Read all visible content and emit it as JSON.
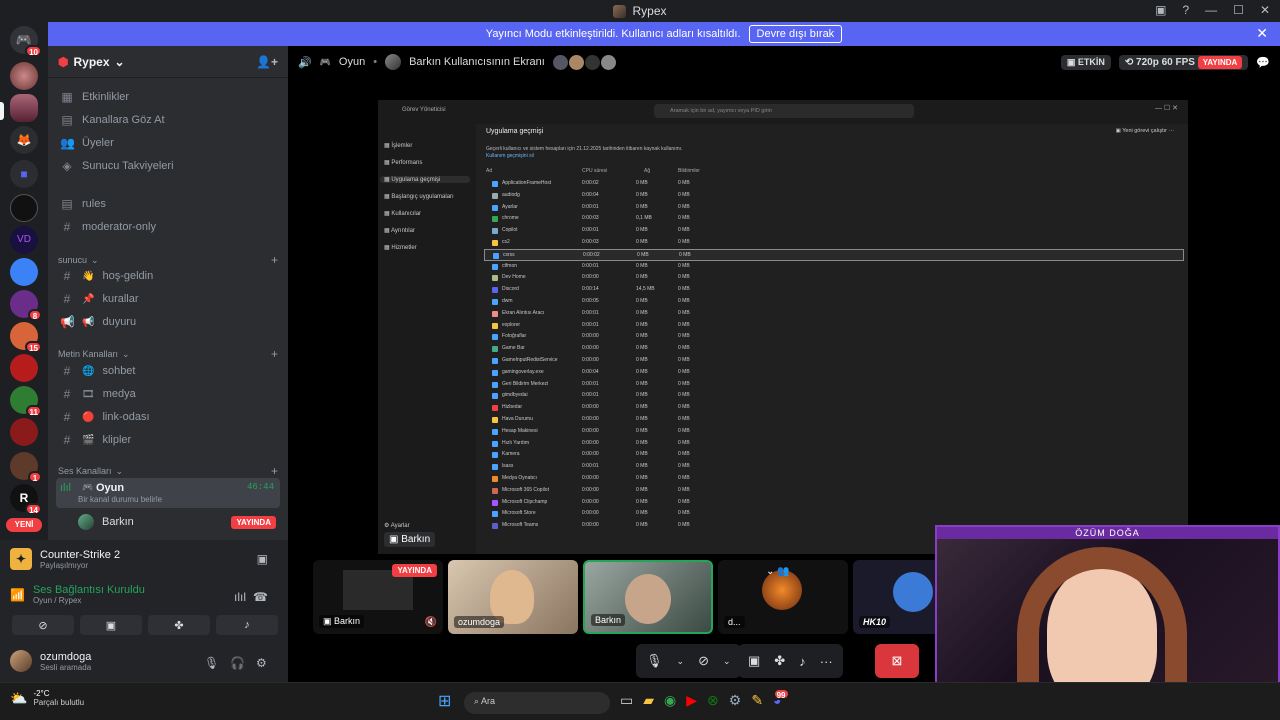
{
  "window": {
    "title": "Rypex"
  },
  "banner": {
    "message": "Yayıncı Modu etkinleştirildi. Kullanıcı adları kısaltıldı.",
    "button": "Devre dışı bırak"
  },
  "rail": {
    "badges": [
      "10",
      "8",
      "15",
      "11",
      "1",
      "14"
    ],
    "new_label": "YENİ"
  },
  "guild": {
    "name": "Rypex",
    "top_items": [
      "Etkinlikler",
      "Kanallara Göz At",
      "Üyeler",
      "Sunucu Takviyeleri"
    ],
    "text_channels_a": [
      "rules",
      "moderator-only"
    ],
    "cat_sunucu": "sunucu",
    "sunucu_channels": [
      "hoş-geldin",
      "kurallar",
      "duyuru"
    ],
    "cat_metin": "Metin Kanalları",
    "metin_channels": [
      "sohbet",
      "medya",
      "link-odası",
      "klipler"
    ],
    "cat_ses": "Ses Kanalları",
    "voice_channel": {
      "name": "Oyun",
      "timer": "46:44",
      "status_hint": "Bir kanal durumu belirle",
      "member": "Barkın",
      "member_badge": "YAYINDA"
    }
  },
  "user_panel": {
    "game": "Counter-Strike 2",
    "game_status": "Paylaşılmıyor",
    "voice_status": "Ses Bağlantısı Kuruldu",
    "voice_location": "Oyun / Rypex",
    "username": "ozumdoga",
    "user_status": "Sesli aramada"
  },
  "stream_header": {
    "channel": "Oyun",
    "screen_title": "Barkın Kullanıcısının Ekranı",
    "active_badge": "ETKİN",
    "quality": "720p 60 FPS",
    "live": "YAYINDA"
  },
  "task_manager": {
    "app_title": "Görev Yöneticisi",
    "search_placeholder": "Aramak için bir ad, yayımcı veya PID girin",
    "sidebar": [
      "İşlemler",
      "Performans",
      "Uygulama geçmişi",
      "Başlangıç uygulamaları",
      "Kullanıcılar",
      "Ayrıntılar",
      "Hizmetler",
      "Ayarlar"
    ],
    "heading": "Uygulama geçmişi",
    "action": "Yeni görevi çalıştır",
    "desc": "Geçerli kullanıcı ve sistem hesapları için 21.12.2025 tarihinden itibaren kaynak kullanımı.",
    "delete_link": "Kullanım geçmişini sil",
    "columns": [
      "Ad",
      "CPU süresi",
      "Ağ",
      "Bildirimler"
    ],
    "rows": [
      [
        "ApplicationFrameHost",
        "0:00:02",
        "0 MB",
        "0 MB"
      ],
      [
        "audiodg",
        "0:00:04",
        "0 MB",
        "0 MB"
      ],
      [
        "Ayarlar",
        "0:00:01",
        "0 MB",
        "0 MB"
      ],
      [
        "chrome",
        "0:00:03",
        "0,1 MB",
        "0 MB"
      ],
      [
        "Copilot",
        "0:00:01",
        "0 MB",
        "0 MB"
      ],
      [
        "cs2",
        "0:00:03",
        "0 MB",
        "0 MB"
      ],
      [
        "csrss",
        "0:00:02",
        "0 MB",
        "0 MB"
      ],
      [
        "ctfmon",
        "0:00:01",
        "0 MB",
        "0 MB"
      ],
      [
        "Dev Home",
        "0:00:00",
        "0 MB",
        "0 MB"
      ],
      [
        "Discord",
        "0:00:14",
        "14,5 MB",
        "0 MB"
      ],
      [
        "dwm",
        "0:00:05",
        "0 MB",
        "0 MB"
      ],
      [
        "Ekran Alıntısı Aracı",
        "0:00:01",
        "0 MB",
        "0 MB"
      ],
      [
        "explorer",
        "0:00:01",
        "0 MB",
        "0 MB"
      ],
      [
        "Fotoğraflar",
        "0:00:00",
        "0 MB",
        "0 MB"
      ],
      [
        "Game Bar",
        "0:00:00",
        "0 MB",
        "0 MB"
      ],
      [
        "GameInputRedistService",
        "0:00:00",
        "0 MB",
        "0 MB"
      ],
      [
        "gamingoverlay.exe",
        "0:00:04",
        "0 MB",
        "0 MB"
      ],
      [
        "Geri Bildirim Merkezi",
        "0:00:01",
        "0 MB",
        "0 MB"
      ],
      [
        "gimdbyedai",
        "0:00:01",
        "0 MB",
        "0 MB"
      ],
      [
        "Hizbedar",
        "0:00:00",
        "0 MB",
        "0 MB"
      ],
      [
        "Hava Durumu",
        "0:00:00",
        "0 MB",
        "0 MB"
      ],
      [
        "Hesap Makinesi",
        "0:00:00",
        "0 MB",
        "0 MB"
      ],
      [
        "Hızlı Yardım",
        "0:00:00",
        "0 MB",
        "0 MB"
      ],
      [
        "Kamera",
        "0:00:00",
        "0 MB",
        "0 MB"
      ],
      [
        "lsass",
        "0:00:01",
        "0 MB",
        "0 MB"
      ],
      [
        "Medya Oynatıcı",
        "0:00:00",
        "0 MB",
        "0 MB"
      ],
      [
        "Microsoft 365 Copilot",
        "0:00:00",
        "0 MB",
        "0 MB"
      ],
      [
        "Microsoft Clipchamp",
        "0:00:00",
        "0 MB",
        "0 MB"
      ],
      [
        "Microsoft Store",
        "0:00:00",
        "0 MB",
        "0 MB"
      ],
      [
        "Microsoft Teams",
        "0:00:00",
        "0 MB",
        "0 MB"
      ]
    ],
    "stream_label": "Barkın"
  },
  "tiles": [
    {
      "name": "Barkın",
      "live": "YAYINDA"
    },
    {
      "name": "ozumdoga"
    },
    {
      "name": "Barkın"
    },
    {
      "name": "d..."
    },
    {
      "name": "HK10"
    }
  ],
  "webcam": {
    "name": "ÖZÜM DOĞA"
  },
  "taskbar": {
    "weather_temp": "-2°C",
    "weather_desc": "Parçalı bulutlu",
    "search": "Ara",
    "discord_badge": "99"
  }
}
